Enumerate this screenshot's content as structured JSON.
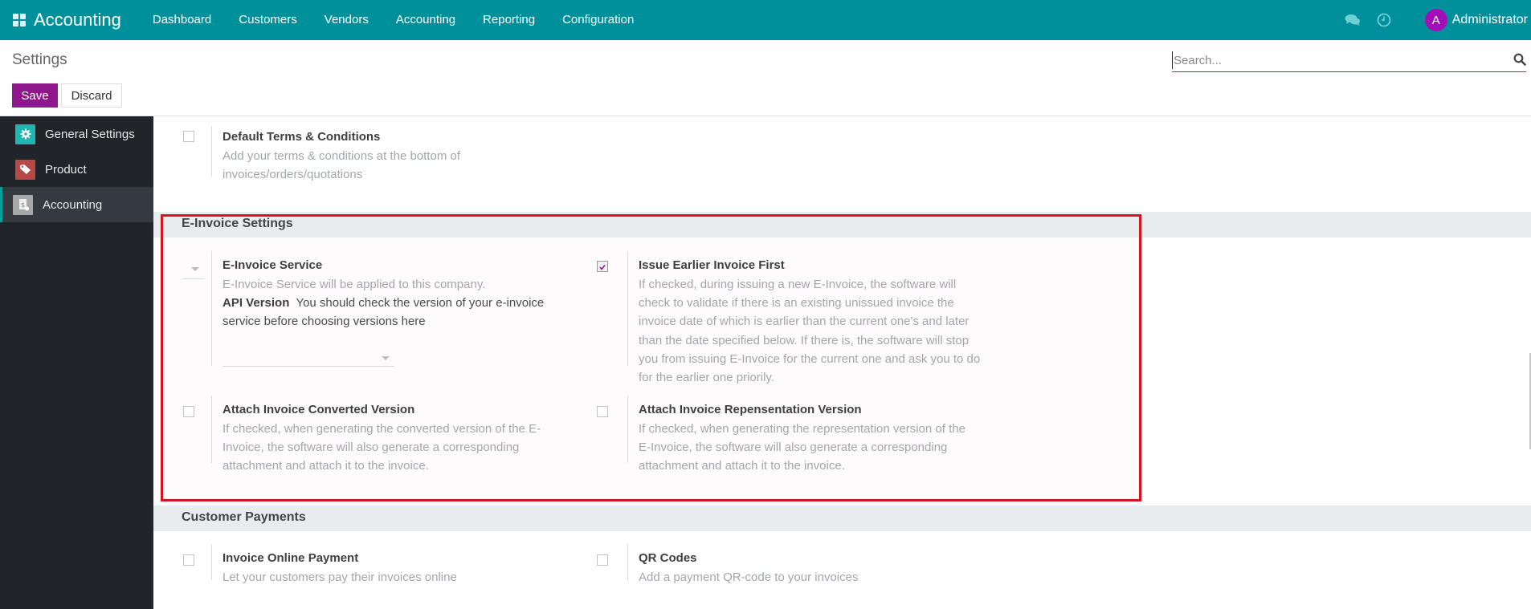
{
  "navbar": {
    "app_name": "Accounting",
    "menu": [
      "Dashboard",
      "Customers",
      "Vendors",
      "Accounting",
      "Reporting",
      "Configuration"
    ],
    "icons": [
      "apps-grid-icon",
      "chat-icon",
      "clock-icon"
    ],
    "user": {
      "initial": "A",
      "name": "Administrator",
      "avatar_color": "#a20fb8"
    },
    "brand_color": "#00909b"
  },
  "control_panel": {
    "title": "Settings",
    "save_label": "Save",
    "discard_label": "Discard",
    "search_placeholder": "Search...",
    "search_value": ""
  },
  "sidebar": {
    "items": [
      {
        "label": "General Settings",
        "icon": "gear-icon",
        "color": "#1fb5b0",
        "active": false
      },
      {
        "label": "Product",
        "icon": "tag-icon",
        "color": "#b84848",
        "active": false
      },
      {
        "label": "Accounting",
        "icon": "invoice-icon",
        "color": "#a8a8a8",
        "active": true
      }
    ]
  },
  "content": {
    "default_terms": {
      "title": "Default Terms & Conditions",
      "description": "Add your terms & conditions at the bottom of invoices/orders/quotations",
      "checked": false
    },
    "einvoice_section": {
      "title": "E-Invoice Settings",
      "service": {
        "title": "E-Invoice Service",
        "description": "E-Invoice Service will be applied to this company.",
        "selected_value": "",
        "api_version_label": "API Version",
        "api_version_help": "You should check the version of your e-invoice service before choosing versions here",
        "api_version_value": ""
      },
      "issue_earlier": {
        "title": "Issue Earlier Invoice First",
        "description": "If checked, during issuing a new E-Invoice, the software will check to validate if there is an existing unissued invoice the invoice date of which is earlier than the current one's and later than the date specified below. If there is, the software will stop you from issuing E-Invoice for the current one and ask you to do for the earlier one priorily.",
        "checked": true
      },
      "attach_converted": {
        "title": "Attach Invoice Converted Version",
        "description": "If checked, when generating the converted version of the E-Invoice, the software will also generate a corresponding attachment and attach it to the invoice.",
        "checked": false
      },
      "attach_representation": {
        "title": "Attach Invoice Repensentation Version",
        "description": "If checked, when generating the representation version of the E-Invoice, the software will also generate a corresponding attachment and attach it to the invoice.",
        "checked": false
      },
      "highlight_color": "#d6141b"
    },
    "customer_payments": {
      "title": "Customer Payments",
      "online_payment": {
        "title": "Invoice Online Payment",
        "description": "Let your customers pay their invoices online",
        "checked": false
      },
      "qr_codes": {
        "title": "QR Codes",
        "description": "Add a payment QR-code to your invoices",
        "checked": false
      }
    }
  }
}
